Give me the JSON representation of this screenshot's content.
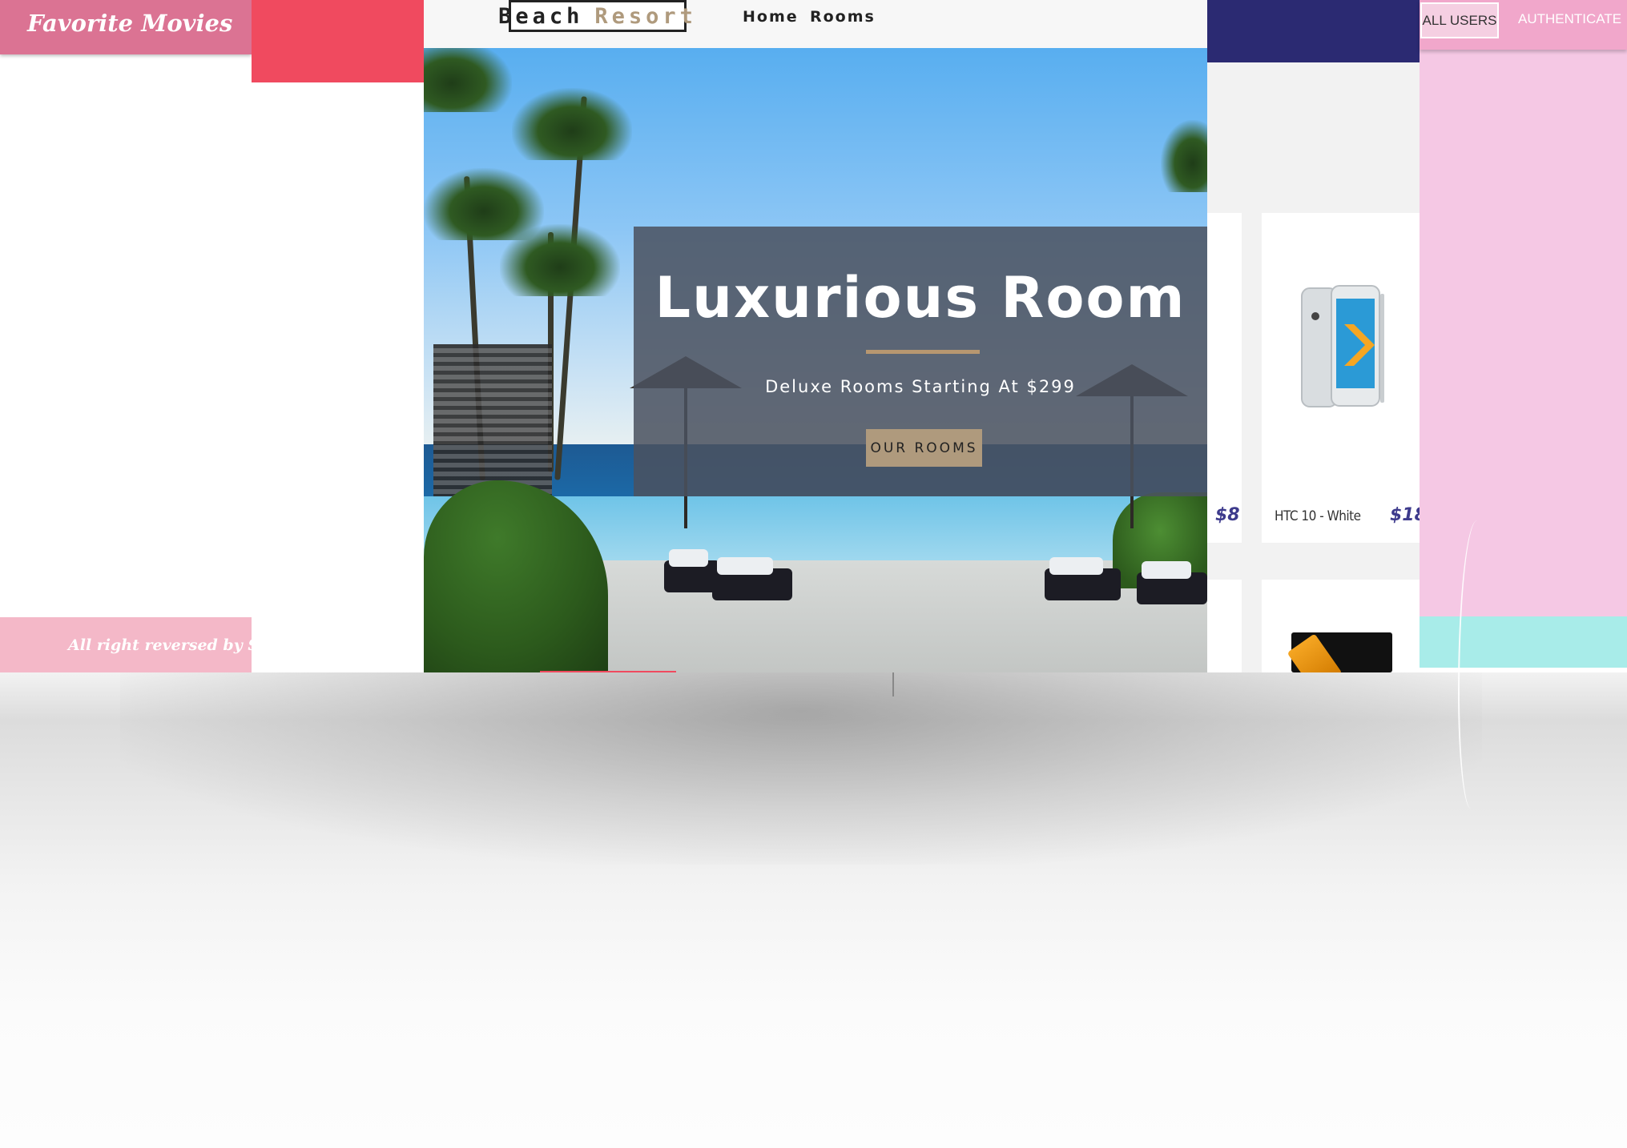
{
  "movies_app": {
    "title": "Favorite Movies",
    "footer": "All right reversed by Sehe"
  },
  "resort": {
    "logo_part1": "Beach",
    "logo_part2": "Resort",
    "nav": {
      "home": "Home",
      "rooms": "Rooms"
    },
    "hero": {
      "title": "Luxurious Room",
      "subtitle": "Deluxe Rooms Starting At $299",
      "button": "OUR ROOMS"
    }
  },
  "shop": {
    "left_price": "$8",
    "product_name": "HTC 10 - White",
    "product_price": "$18"
  },
  "admin": {
    "all_users": "ALL USERS",
    "authenticate": "AUTHENTICATE"
  },
  "colors": {
    "movies_header": "#db7393",
    "resort_accent": "#af9a7d",
    "red_block": "#f04a5f",
    "navy_bar": "#2b2a72",
    "pink_panel": "#f5c8e4",
    "teal_strip": "#a8ece9"
  }
}
